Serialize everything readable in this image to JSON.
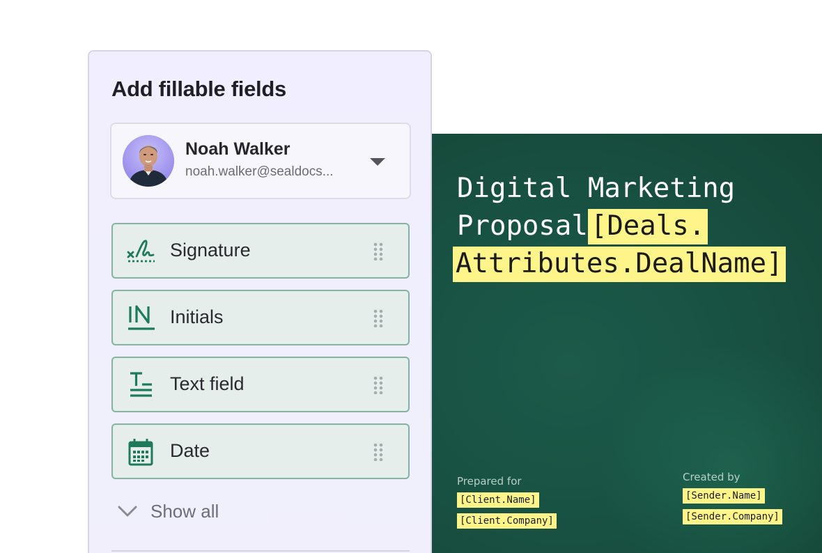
{
  "panel": {
    "title": "Add fillable fields",
    "user": {
      "name": "Noah Walker",
      "email": "noah.walker@sealdocs..."
    },
    "fields": [
      {
        "label": "Signature",
        "icon": "signature-icon"
      },
      {
        "label": "Initials",
        "icon": "initials-icon"
      },
      {
        "label": "Text field",
        "icon": "text-field-icon"
      },
      {
        "label": "Date",
        "icon": "calendar-icon"
      }
    ],
    "show_all_label": "Show all"
  },
  "document": {
    "title_line1": "Digital Marketing",
    "title_line2_plain": "Proposal",
    "title_line2_token": "[Deals.",
    "title_line3_token": "Attributes.DealName]",
    "prepared_for_label": "Prepared for",
    "client_name_token": "[Client.Name]",
    "client_company_token": "[Client.Company]",
    "created_by_label": "Created by",
    "sender_name_token": "[Sender.Name]",
    "sender_company_token": "[Sender.Company]"
  },
  "colors": {
    "accent_green": "#1f7a5a",
    "highlight_yellow": "#fdf58a",
    "document_bg": "#174c3d",
    "panel_bg": "#f1efff"
  }
}
